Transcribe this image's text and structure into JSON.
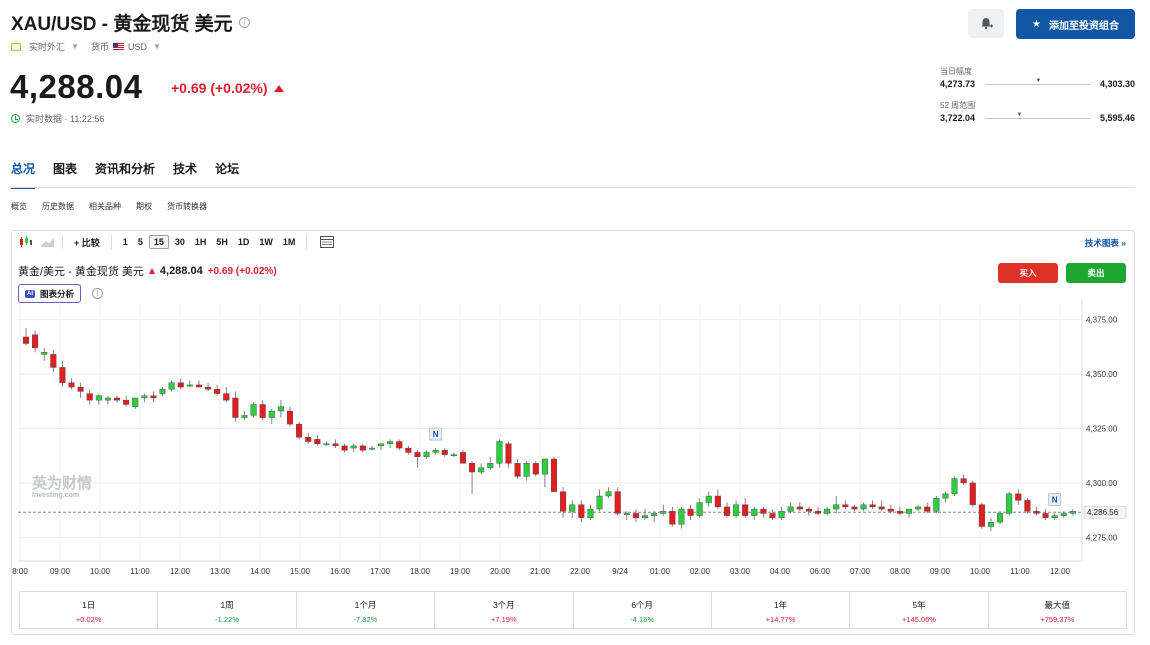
{
  "header": {
    "title": "XAU/USD - 黄金现货 美元",
    "market_type": "实时外汇",
    "currency_label": "货币",
    "currency": "USD",
    "price": "4,288.04",
    "change": "+0.69 (+0.02%)",
    "realtime_label": "实时数据 · 11:22:56",
    "add_portfolio": "添加至投资组合"
  },
  "ranges": {
    "day_label": "当日幅度",
    "day_low": "4,273.73",
    "day_high": "4,303.30",
    "day_fraction": 0.48,
    "week52_label": "52 周范围",
    "week52_low": "3,722.04",
    "week52_high": "5,595.46",
    "week52_fraction": 0.3
  },
  "tabs": [
    "总况",
    "图表",
    "资讯和分析",
    "技术",
    "论坛"
  ],
  "subtabs": [
    "概览",
    "历史数据",
    "相关品种",
    "期权",
    "货币转换器"
  ],
  "toolbar": {
    "compare": "比较",
    "intervals": [
      "1",
      "5",
      "15",
      "30",
      "1H",
      "5H",
      "1D",
      "1W",
      "1M"
    ],
    "selected_interval": "15",
    "tech_chart": "技术图表 »"
  },
  "chart_header": {
    "title": "黄金/美元 - 黄金现货 美元",
    "price": "4,288.04",
    "change": "+0.69 (+0.02%)",
    "ai_badge": "AI",
    "ai_label": "图表分析",
    "buy": "买入",
    "sell": "卖出",
    "watermark_cn": "英为财情",
    "watermark_en": "Investing.com"
  },
  "chart_data": {
    "type": "candlestick",
    "y_ticks": [
      "4,375.00",
      "4,350.00",
      "4,325.00",
      "4,300.00",
      "4,275.00"
    ],
    "y_tick_values": [
      4375,
      4350,
      4325,
      4300,
      4275
    ],
    "ylim": [
      4266,
      4378
    ],
    "x_labels": [
      "8:00",
      "09:00",
      "10:00",
      "11:00",
      "12:00",
      "13:00",
      "14:00",
      "15:00",
      "16:00",
      "17:00",
      "18:00",
      "19:00",
      "20:00",
      "21:00",
      "22:00",
      "9/24",
      "01:00",
      "02:00",
      "03:00",
      "04:00",
      "06:00",
      "07:00",
      "08:00",
      "09:00",
      "10:00",
      "11:00",
      "12:00"
    ],
    "last_price": "4,286.56",
    "last_value": 4286.56,
    "news_markers": [
      {
        "index": 45,
        "label": "N"
      },
      {
        "index": 113,
        "label": "N"
      }
    ],
    "candles": [
      [
        4367,
        4371,
        4363,
        4364
      ],
      [
        4368,
        4370,
        4360,
        4362
      ],
      [
        4359,
        4362,
        4356,
        4360
      ],
      [
        4359,
        4361,
        4351,
        4353
      ],
      [
        4353,
        4356,
        4344,
        4346
      ],
      [
        4346,
        4348,
        4343,
        4344
      ],
      [
        4344,
        4346,
        4339,
        4342
      ],
      [
        4341,
        4343,
        4336,
        4338
      ],
      [
        4338,
        4341,
        4336,
        4340
      ],
      [
        4338,
        4340,
        4336,
        4339
      ],
      [
        4339,
        4340,
        4337,
        4338
      ],
      [
        4338,
        4340,
        4335,
        4336
      ],
      [
        4335,
        4339,
        4334,
        4339
      ],
      [
        4339,
        4341,
        4337,
        4340
      ],
      [
        4340,
        4342,
        4337,
        4339
      ],
      [
        4341,
        4344,
        4340,
        4343
      ],
      [
        4343,
        4347,
        4342,
        4346
      ],
      [
        4346,
        4348,
        4343,
        4344
      ],
      [
        4345,
        4347,
        4344,
        4345
      ],
      [
        4345,
        4347,
        4344,
        4344
      ],
      [
        4344,
        4346,
        4342,
        4343
      ],
      [
        4343,
        4345,
        4340,
        4341
      ],
      [
        4341,
        4344,
        4337,
        4338
      ],
      [
        4339,
        4342,
        4328,
        4330
      ],
      [
        4330,
        4333,
        4329,
        4331
      ],
      [
        4331,
        4337,
        4330,
        4336
      ],
      [
        4336,
        4338,
        4329,
        4330
      ],
      [
        4330,
        4334,
        4327,
        4333
      ],
      [
        4333,
        4338,
        4330,
        4335
      ],
      [
        4333,
        4335,
        4326,
        4327
      ],
      [
        4327,
        4328,
        4320,
        4321
      ],
      [
        4321,
        4323,
        4318,
        4319
      ],
      [
        4320,
        4322,
        4317,
        4318
      ],
      [
        4318,
        4319,
        4317,
        4318
      ],
      [
        4318,
        4320,
        4316,
        4317
      ],
      [
        4317,
        4318,
        4314,
        4315
      ],
      [
        4316,
        4318,
        4314,
        4317
      ],
      [
        4317,
        4318,
        4314,
        4315
      ],
      [
        4316,
        4317,
        4315,
        4316
      ],
      [
        4317,
        4318,
        4315,
        4318
      ],
      [
        4318,
        4320,
        4316,
        4319
      ],
      [
        4319,
        4320,
        4315,
        4316
      ],
      [
        4316,
        4317,
        4313,
        4314
      ],
      [
        4314,
        4315,
        4307,
        4312
      ],
      [
        4312,
        4315,
        4311,
        4314
      ],
      [
        4314,
        4316,
        4313,
        4315
      ],
      [
        4315,
        4316,
        4312,
        4313
      ],
      [
        4313,
        4314,
        4312,
        4313
      ],
      [
        4314,
        4315,
        4309,
        4309
      ],
      [
        4309,
        4310,
        4295,
        4305
      ],
      [
        4305,
        4309,
        4304,
        4307
      ],
      [
        4307,
        4312,
        4306,
        4309
      ],
      [
        4309,
        4320,
        4307,
        4319
      ],
      [
        4318,
        4319,
        4307,
        4309
      ],
      [
        4309,
        4311,
        4302,
        4303
      ],
      [
        4303,
        4310,
        4301,
        4309
      ],
      [
        4309,
        4310,
        4303,
        4304
      ],
      [
        4304,
        4311,
        4298,
        4311
      ],
      [
        4311,
        4312,
        4296,
        4296
      ],
      [
        4296,
        4298,
        4284,
        4287
      ],
      [
        4287,
        4292,
        4284,
        4290
      ],
      [
        4290,
        4292,
        4282,
        4284
      ],
      [
        4284,
        4290,
        4283,
        4288
      ],
      [
        4288,
        4297,
        4287,
        4294
      ],
      [
        4294,
        4298,
        4293,
        4296
      ],
      [
        4296,
        4298,
        4285,
        4286
      ],
      [
        4286,
        4287,
        4283,
        4286
      ],
      [
        4286,
        4288,
        4282,
        4284
      ],
      [
        4284,
        4288,
        4283,
        4285
      ],
      [
        4285,
        4287,
        4282,
        4286
      ],
      [
        4286,
        4290,
        4285,
        4287
      ],
      [
        4287,
        4289,
        4280,
        4281
      ],
      [
        4281,
        4289,
        4279,
        4288
      ],
      [
        4288,
        4290,
        4283,
        4285
      ],
      [
        4285,
        4293,
        4284,
        4291
      ],
      [
        4291,
        4296,
        4289,
        4294
      ],
      [
        4294,
        4297,
        4288,
        4289
      ],
      [
        4289,
        4291,
        4284,
        4285
      ],
      [
        4285,
        4292,
        4284,
        4290
      ],
      [
        4290,
        4293,
        4284,
        4285
      ],
      [
        4285,
        4289,
        4283,
        4288
      ],
      [
        4288,
        4289,
        4284,
        4286
      ],
      [
        4286,
        4288,
        4283,
        4284
      ],
      [
        4284,
        4289,
        4283,
        4287
      ],
      [
        4287,
        4291,
        4286,
        4289
      ],
      [
        4289,
        4291,
        4287,
        4288
      ],
      [
        4288,
        4289,
        4285,
        4287
      ],
      [
        4287,
        4289,
        4285,
        4286
      ],
      [
        4286,
        4289,
        4285,
        4288
      ],
      [
        4288,
        4294,
        4286,
        4290
      ],
      [
        4290,
        4292,
        4288,
        4289
      ],
      [
        4289,
        4290,
        4287,
        4288
      ],
      [
        4288,
        4291,
        4287,
        4290
      ],
      [
        4290,
        4292,
        4288,
        4289
      ],
      [
        4289,
        4292,
        4287,
        4288
      ],
      [
        4288,
        4290,
        4286,
        4287
      ],
      [
        4287,
        4289,
        4285,
        4286
      ],
      [
        4286,
        4288,
        4284,
        4288
      ],
      [
        4288,
        4290,
        4287,
        4289
      ],
      [
        4289,
        4291,
        4286,
        4287
      ],
      [
        4287,
        4294,
        4286,
        4293
      ],
      [
        4293,
        4296,
        4291,
        4295
      ],
      [
        4295,
        4303,
        4294,
        4302
      ],
      [
        4302,
        4304,
        4299,
        4300
      ],
      [
        4300,
        4301,
        4289,
        4290
      ],
      [
        4290,
        4291,
        4279,
        4280
      ],
      [
        4280,
        4284,
        4278,
        4282
      ],
      [
        4282,
        4287,
        4281,
        4286
      ],
      [
        4286,
        4296,
        4285,
        4295
      ],
      [
        4295,
        4297,
        4290,
        4292
      ],
      [
        4292,
        4293,
        4286,
        4287
      ],
      [
        4287,
        4289,
        4285,
        4286
      ],
      [
        4286,
        4288,
        4283,
        4284
      ],
      [
        4284,
        4286,
        4283,
        4285
      ],
      [
        4285,
        4287,
        4284,
        4286
      ],
      [
        4286,
        4288,
        4285,
        4287
      ]
    ]
  },
  "performance": [
    {
      "label": "1日",
      "value": "+0.02%",
      "dir": "pos"
    },
    {
      "label": "1周",
      "value": "-1.22%",
      "dir": "neg"
    },
    {
      "label": "1个月",
      "value": "-7.82%",
      "dir": "neg"
    },
    {
      "label": "3个月",
      "value": "+7.19%",
      "dir": "pos"
    },
    {
      "label": "6个月",
      "value": "-4.16%",
      "dir": "neg"
    },
    {
      "label": "1年",
      "value": "+14.77%",
      "dir": "pos"
    },
    {
      "label": "5年",
      "value": "+145.06%",
      "dir": "pos"
    },
    {
      "label": "最大值",
      "value": "+759.37%",
      "dir": "pos"
    }
  ],
  "colors": {
    "up": "#2ecc40",
    "down": "#e02020",
    "accent": "#1256a6",
    "red_text": "#d9202c",
    "green_text": "#1b9e3e"
  }
}
